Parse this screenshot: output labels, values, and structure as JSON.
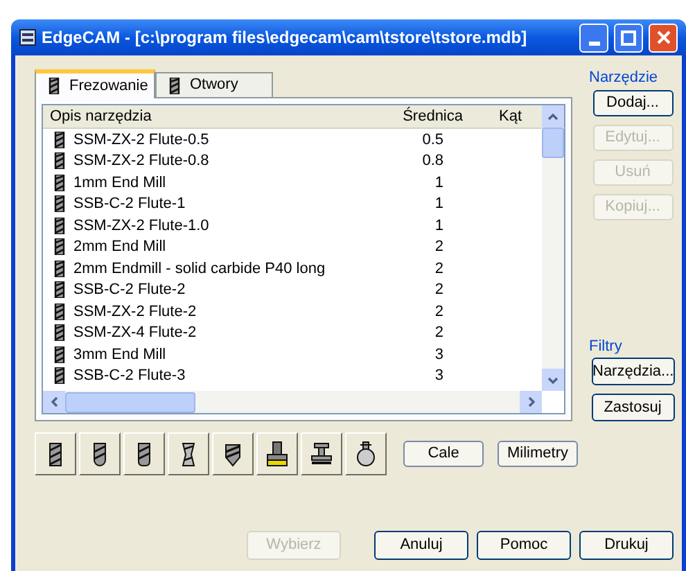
{
  "window": {
    "title": "EdgeCAM - [c:\\program files\\edgecam\\cam\\tstore\\tstore.mdb]"
  },
  "tabs": [
    {
      "label": "Frezowanie",
      "selected": true
    },
    {
      "label": "Otwory",
      "selected": false
    }
  ],
  "table": {
    "columns": [
      "Opis narzędzia",
      "Średnica",
      "Kąt"
    ],
    "rows": [
      {
        "name": "SSM-ZX-2 Flute-0.5",
        "diameter": "0.5"
      },
      {
        "name": "SSM-ZX-2 Flute-0.8",
        "diameter": "0.8"
      },
      {
        "name": "1mm End Mill",
        "diameter": "1"
      },
      {
        "name": "SSB-C-2 Flute-1",
        "diameter": "1"
      },
      {
        "name": "SSM-ZX-2 Flute-1.0",
        "diameter": "1"
      },
      {
        "name": "2mm End Mill",
        "diameter": "2"
      },
      {
        "name": "2mm Endmill - solid carbide P40 long",
        "diameter": "2"
      },
      {
        "name": "SSB-C-2 Flute-2",
        "diameter": "2"
      },
      {
        "name": "SSM-ZX-2 Flute-2",
        "diameter": "2"
      },
      {
        "name": "SSM-ZX-4 Flute-2",
        "diameter": "2"
      },
      {
        "name": "3mm End Mill",
        "diameter": "3"
      },
      {
        "name": "SSB-C-2 Flute-3",
        "diameter": "3"
      }
    ]
  },
  "tool_group": {
    "label": "Narzędzie",
    "buttons": [
      {
        "label": "Dodaj...",
        "disabled": false
      },
      {
        "label": "Edytuj...",
        "disabled": true
      },
      {
        "label": "Usuń",
        "disabled": true
      },
      {
        "label": "Kopiuj...",
        "disabled": true
      }
    ]
  },
  "filter_group": {
    "label": "Filtry",
    "buttons": [
      {
        "label": "Narzędzia...",
        "disabled": false
      },
      {
        "label": "Zastosuj",
        "disabled": false
      }
    ]
  },
  "units": [
    {
      "label": "Cale",
      "selected": false
    },
    {
      "label": "Milimetry",
      "selected": false
    }
  ],
  "footer_buttons": [
    {
      "label": "Wybierz",
      "disabled": true
    },
    {
      "label": "Anuluj",
      "disabled": false
    },
    {
      "label": "Pomoc",
      "disabled": false
    },
    {
      "label": "Drukuj",
      "disabled": false
    }
  ]
}
